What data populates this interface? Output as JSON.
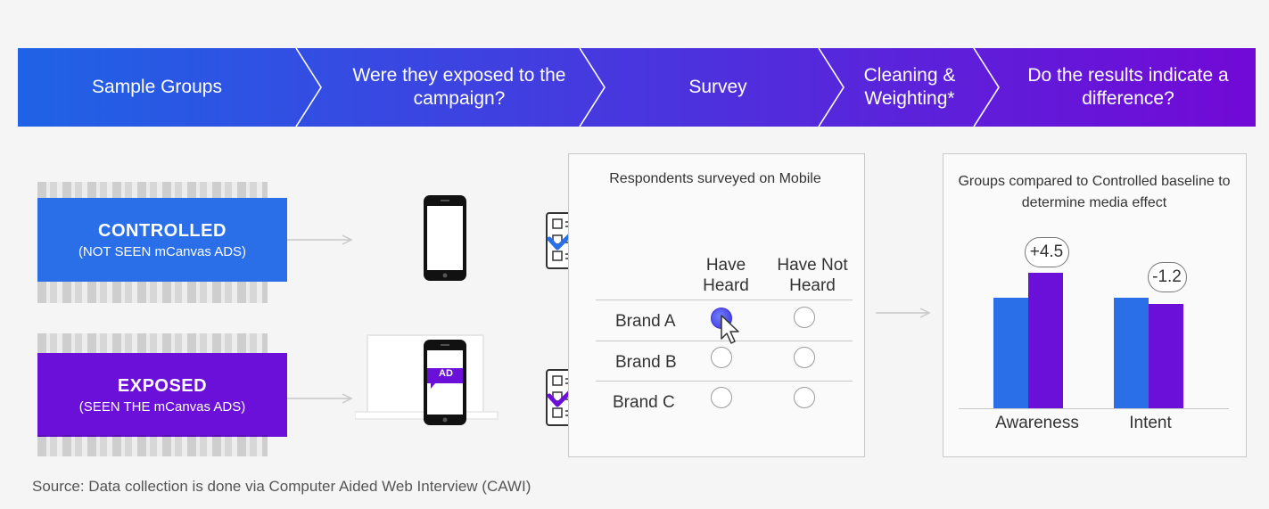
{
  "steps": [
    {
      "label": "Sample Groups"
    },
    {
      "label": "Were they exposed to the campaign?"
    },
    {
      "label": "Survey"
    },
    {
      "label": "Cleaning & Weighting*"
    },
    {
      "label": "Do the results indicate a difference?"
    }
  ],
  "groups": {
    "controlled": {
      "title": "CONTROLLED",
      "subtitle": "(NOT SEEN mCanvas ADS)",
      "color": "#2a6ee8"
    },
    "exposed": {
      "title": "EXPOSED",
      "subtitle": "(SEEN THE mCanvas ADS)",
      "color": "#6a10d8"
    }
  },
  "phone_ad_label": "AD",
  "survey": {
    "title": "Respondents surveyed on Mobile",
    "columns": [
      "Have Heard",
      "Have Not Heard"
    ],
    "rows": [
      {
        "brand": "Brand A",
        "selected": "Have Heard"
      },
      {
        "brand": "Brand B",
        "selected": null
      },
      {
        "brand": "Brand C",
        "selected": null
      }
    ]
  },
  "results": {
    "title": "Groups compared to Controlled baseline to determine media effect",
    "chart_data": {
      "type": "bar",
      "categories": [
        "Awareness",
        "Intent"
      ],
      "series": [
        {
          "name": "",
          "color": "#2a6ee8",
          "values": [
            50,
            50
          ]
        },
        {
          "name": "",
          "color": "#6a10d8",
          "values": [
            54.5,
            48.8
          ]
        }
      ],
      "annotations": [
        "+4.5",
        "-1.2"
      ],
      "ylim": [
        0,
        60
      ]
    }
  },
  "source": "Source: Data collection is done via Computer Aided Web Interview (CAWI)",
  "colors": {
    "gradient_start": "#1f63e6",
    "gradient_end": "#7209d6",
    "blue": "#2a6ee8",
    "purple": "#6a10d8"
  }
}
